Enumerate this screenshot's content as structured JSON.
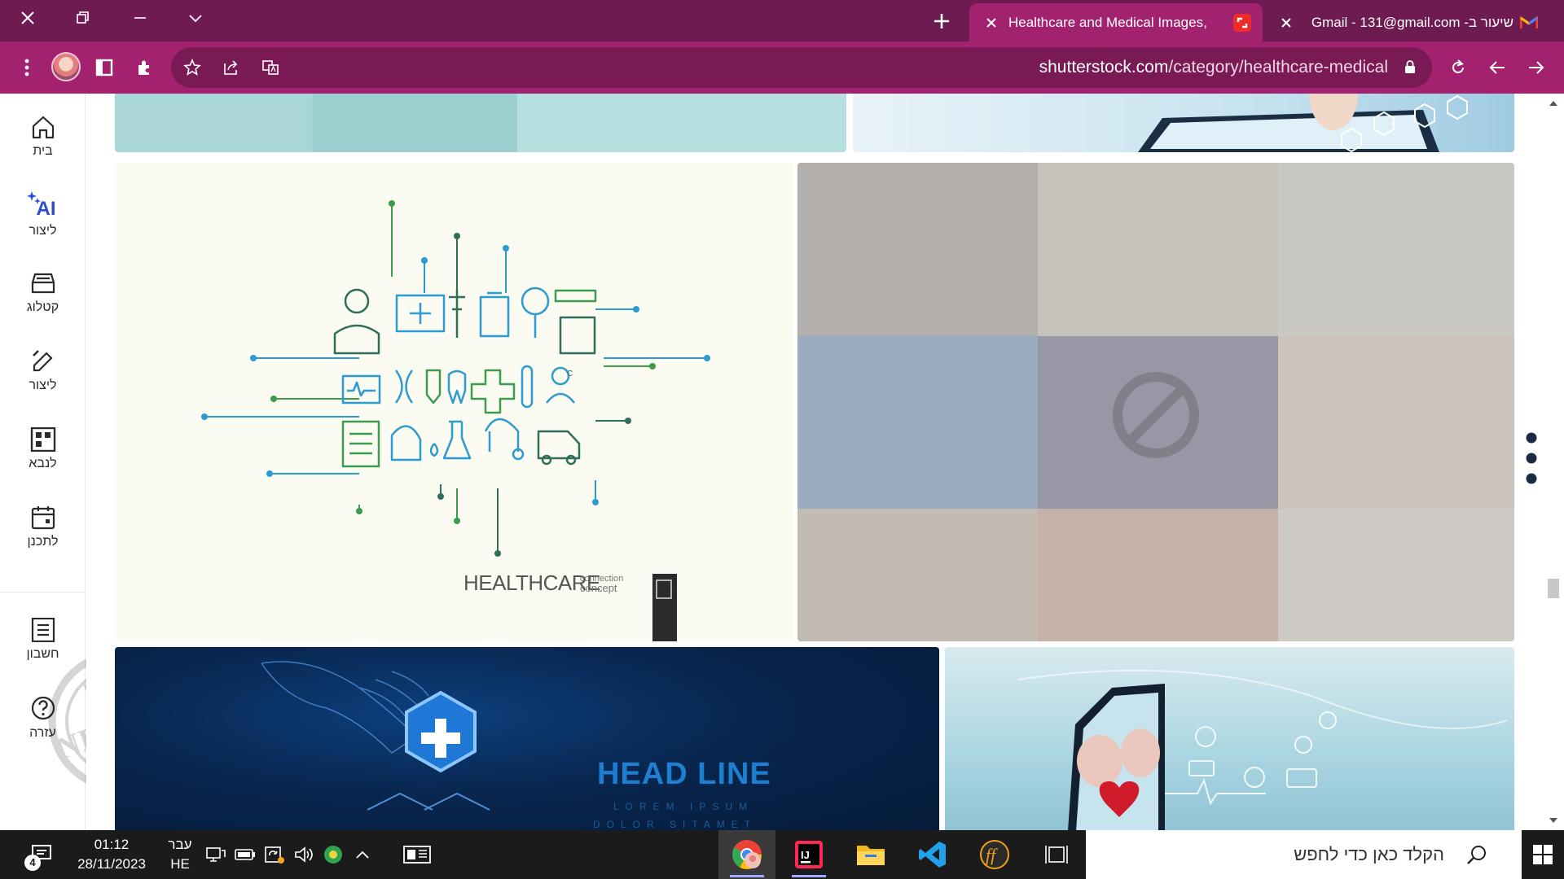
{
  "browser": {
    "tabs": [
      {
        "title": "Healthcare and Medical Images,",
        "favicon": "shutterstock-icon",
        "active": true
      },
      {
        "title": "שיעור ב- Gmail - 131@gmail.com",
        "favicon": "gmail-icon",
        "active": false
      }
    ],
    "address_bar": {
      "host": "shutterstock.com",
      "path": "/category/healthcare-medical"
    },
    "colors": {
      "titlebar": "#6d1b50",
      "toolbar": "#a3226f",
      "omnibox": "#7a1a55"
    }
  },
  "sidebar": {
    "items": [
      {
        "label": "בית",
        "icon": "home-icon"
      },
      {
        "label": "ליצור",
        "icon": "ai-sparkle-icon",
        "badge": "AI"
      },
      {
        "label": "קטלוג",
        "icon": "catalog-icon"
      },
      {
        "label": "ליצור",
        "icon": "edit-pencil-icon"
      },
      {
        "label": "לנבא",
        "icon": "dashboard-grid-icon"
      },
      {
        "label": "לתכנן",
        "icon": "calendar-icon"
      },
      {
        "label": "חשבון",
        "icon": "account-list-icon"
      },
      {
        "label": "עזרה",
        "icon": "help-icon"
      }
    ],
    "watermark": {
      "top": "מוגש",
      "middle": "NETFREE",
      "bottom": "מוגן"
    }
  },
  "content": {
    "healthcare_tile": {
      "caption": "HEALTHCARE",
      "caption_small_top": "connection",
      "caption_small_bottom": "concept"
    },
    "blocked_tile": {
      "icon": "blocked-icon"
    },
    "headline_tile": {
      "headline": "HEAD LINE",
      "line1": "LOREM IPSUM",
      "line2": "DOLOR SITAMET"
    }
  },
  "taskbar": {
    "search_placeholder": "הקלד כאן כדי לחפש",
    "time": "01:12",
    "date": "28/11/2023",
    "lang_top": "עבר",
    "lang_bottom": "HE",
    "notification_count": "4"
  }
}
